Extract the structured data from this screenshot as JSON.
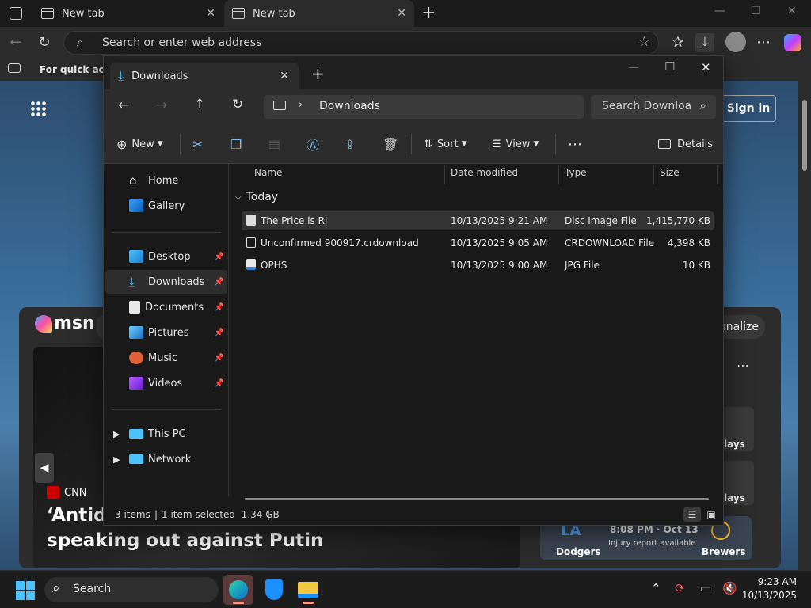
{
  "browser": {
    "tabs": [
      {
        "label": "New tab"
      },
      {
        "label": "New tab"
      }
    ],
    "address_placeholder": "Search or enter web address",
    "favorites_text": "For quick acce",
    "sign_in": "Sign in",
    "msn_logo": "msn",
    "personalize": "onalize",
    "news_source": "CNN",
    "news_headline_1": "‘Antidc",
    "news_headline_2": "speaking out against Putin",
    "sport_time": "8:08 PM · Oct 13",
    "sport_status": "Injury report available",
    "team_home": "Dodgers",
    "team_away": "Brewers",
    "side_label": "lays",
    "accent_color": "#0078d4"
  },
  "explorer": {
    "tab_title": "Downloads",
    "path": "Downloads",
    "search_placeholder": "Search Downloa",
    "commands": {
      "new": "New",
      "sort": "Sort",
      "view": "View",
      "details": "Details"
    },
    "nav": {
      "home": "Home",
      "gallery": "Gallery",
      "pinned": [
        {
          "label": "Desktop"
        },
        {
          "label": "Downloads"
        },
        {
          "label": "Documents"
        },
        {
          "label": "Pictures"
        },
        {
          "label": "Music"
        },
        {
          "label": "Videos"
        }
      ],
      "this_pc": "This PC",
      "network": "Network"
    },
    "columns": {
      "name": "Name",
      "date": "Date modified",
      "type": "Type",
      "size": "Size"
    },
    "group": "Today",
    "files": [
      {
        "name": "The Price is Ri",
        "date": "10/13/2025 9:21 AM",
        "type": "Disc Image File",
        "size": "1,415,770 KB"
      },
      {
        "name": "Unconfirmed 900917.crdownload",
        "date": "10/13/2025 9:05 AM",
        "type": "CRDOWNLOAD File",
        "size": "4,398 KB"
      },
      {
        "name": "OPHS",
        "date": "10/13/2025 9:00 AM",
        "type": "JPG File",
        "size": "10 KB"
      }
    ],
    "status": {
      "items": "3 items",
      "selected": "1 item selected  1.34 GB"
    }
  },
  "taskbar": {
    "search": "Search",
    "time": "9:23 AM",
    "date": "10/13/2025"
  }
}
